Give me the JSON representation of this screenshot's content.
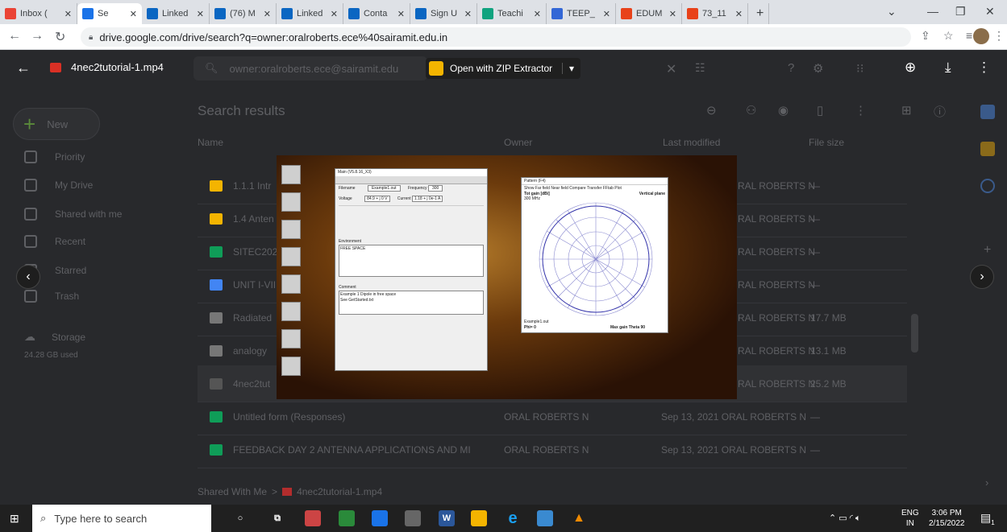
{
  "tabs": [
    {
      "label": "Inbox (",
      "icon": "gmail-icon",
      "color": "#ea4335"
    },
    {
      "label": "Se",
      "icon": "drive-icon",
      "color": "#1a73e8",
      "active": true
    },
    {
      "label": "Linked",
      "icon": "linkedin-icon",
      "color": "#0a66c2"
    },
    {
      "label": "(76) M",
      "icon": "linkedin-icon",
      "color": "#0a66c2"
    },
    {
      "label": "Linked",
      "icon": "linkedin-video-icon",
      "color": "#0a66c2"
    },
    {
      "label": "Conta",
      "icon": "linkedin-icon",
      "color": "#0a66c2"
    },
    {
      "label": "Sign U",
      "icon": "linkedin-icon",
      "color": "#0a66c2"
    },
    {
      "label": "Teachi",
      "icon": "teach-icon",
      "color": "#10a37f"
    },
    {
      "label": "TEEP_",
      "icon": "sheet-icon",
      "color": "#3367d6"
    },
    {
      "label": "EDUM",
      "icon": "edu-icon",
      "color": "#e8421a"
    },
    {
      "label": "73_11",
      "icon": "edu-icon",
      "color": "#e8421a"
    }
  ],
  "new_tab": "+",
  "url": "drive.google.com/drive/search?q=owner:oralroberts.ece%40sairamit.edu.in",
  "viewer": {
    "file_name": "4nec2tutorial-1.mp4",
    "open_with": "Open with ZIP Extractor",
    "search_text": "owner:oralroberts.ece@sairamit.edu"
  },
  "drive": {
    "new_label": "New",
    "search_results": "Search results",
    "col_name": "Name",
    "col_owner": "Owner",
    "col_modified": "Last modified",
    "col_size": "File size",
    "sidebar": [
      {
        "label": "Priority",
        "icon": "priority-icon"
      },
      {
        "label": "My Drive",
        "icon": "my-drive-icon"
      },
      {
        "label": "Shared with me",
        "icon": "shared-icon"
      },
      {
        "label": "Recent",
        "icon": "recent-icon"
      },
      {
        "label": "Starred",
        "icon": "starred-icon"
      },
      {
        "label": "Trash",
        "icon": "trash-icon"
      }
    ],
    "storage_label": "Storage",
    "storage_used": "24.28 GB used",
    "rows": [
      {
        "name": "1.1.1 Intr",
        "owner": "RAL ROBERTS N",
        "size": "—",
        "color": "#f4b400"
      },
      {
        "name": "1.4 Anten",
        "owner": "RAL ROBERTS N",
        "size": "—",
        "color": "#f4b400"
      },
      {
        "name": "SITEC202",
        "owner": "RAL ROBERTS N",
        "size": "—",
        "color": "#0f9d58"
      },
      {
        "name": "UNIT I-VII",
        "owner": "RAL ROBERTS N",
        "size": "—",
        "color": "#4285f4"
      },
      {
        "name": "Radiated",
        "owner": "RAL ROBERTS N",
        "size": "17.7 MB",
        "color": "#777"
      },
      {
        "name": "analogy",
        "owner": "RAL ROBERTS N",
        "size": "13.1 MB",
        "color": "#777"
      },
      {
        "name": "4nec2tut",
        "owner": "RAL ROBERTS N",
        "size": "25.2 MB",
        "color": "#555"
      },
      {
        "name": "Untitled form (Responses)",
        "owner": "ORAL ROBERTS N",
        "modified": "Sep 13, 2021 ORAL ROBERTS N",
        "size": "—",
        "color": "#0f9d58"
      },
      {
        "name": "FEEDBACK DAY 2 ANTENNA APPLICATIONS AND MI",
        "owner": "ORAL ROBERTS N",
        "modified": "Sep 13, 2021 ORAL ROBERTS N",
        "size": "—",
        "color": "#0f9d58"
      }
    ],
    "breadcrumb_root": "Shared With Me",
    "breadcrumb_sep": ">",
    "breadcrumb_file": "4nec2tutorial-1.mp4"
  },
  "video": {
    "main_title": "Main (V5.8.16_X3)",
    "pattern_title": "Pattern  (F4)",
    "pattern_menu": "Show  Far field  Near field  Compare  Transfer  FFtab  Plot",
    "pattern_gain": "Tot gain [dBi]",
    "pattern_plane": "Vertical plane",
    "pattern_freq": "300 MHz",
    "pattern_file": "Example1.out",
    "pattern_phi": "Phi= 0",
    "pattern_maxgain": "Max gain Theta 90",
    "main_filename_label": "Filename",
    "main_filename": "Example1.out",
    "main_freq_label": "Frequency",
    "main_freq": "300",
    "main_voltage_label": "Voltage",
    "main_voltage": "84.9 + j 0 V",
    "main_current_label": "Current",
    "main_current": "1.18 + j 0e-1 A",
    "main_env_label": "Environment",
    "main_env": "FREE SPACE",
    "main_comment_label": "Comment",
    "main_comment": "Example 1     Dipole in free space",
    "main_comment2": "See GetStarted.txt"
  },
  "taskbar": {
    "search_placeholder": "Type here to search",
    "lang": "ENG",
    "region": "IN",
    "time": "3:06 PM",
    "date": "2/15/2022",
    "notif_count": "1"
  }
}
